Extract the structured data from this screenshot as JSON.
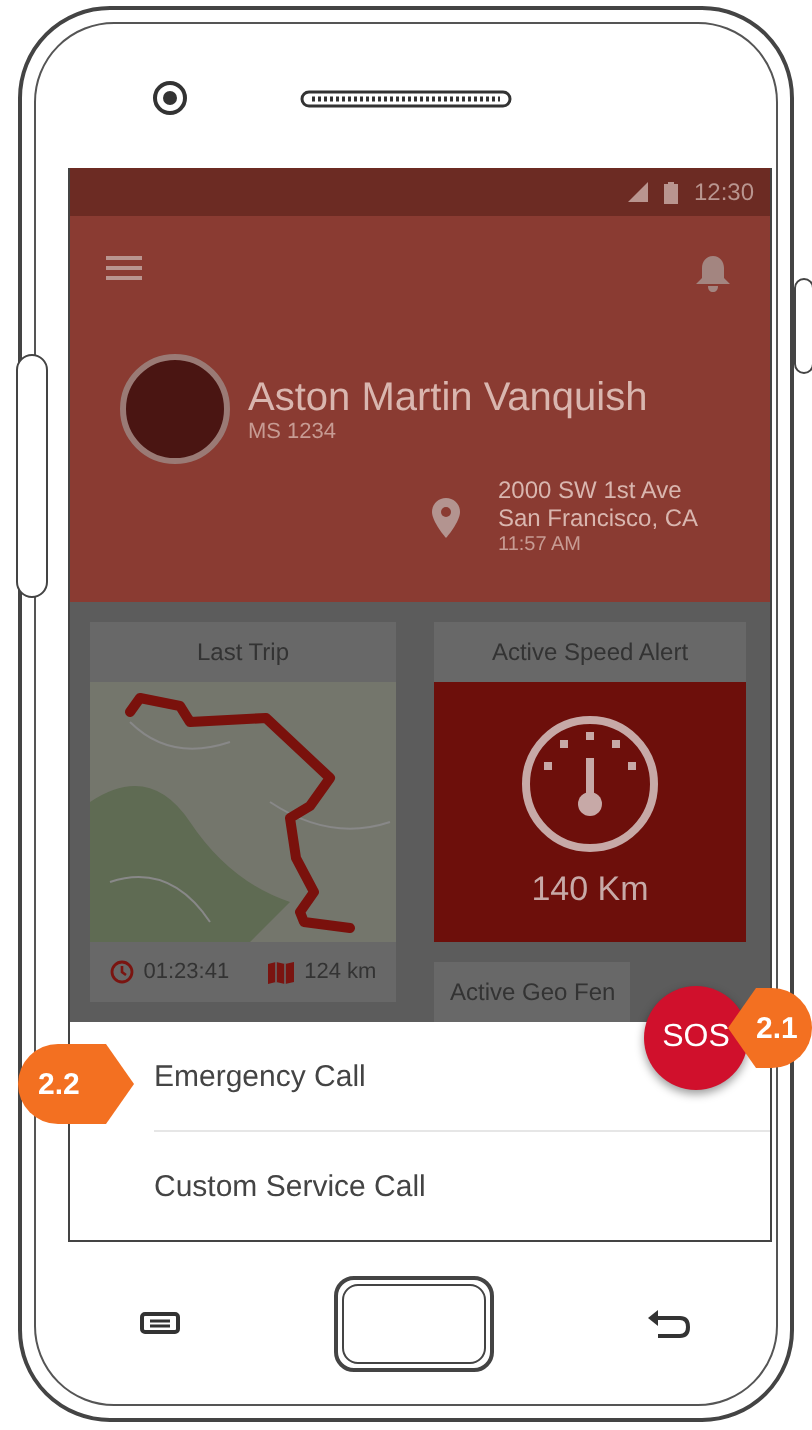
{
  "status_bar": {
    "time": "12:30"
  },
  "vehicle": {
    "name": "Aston Martin Vanquish",
    "plate": "MS 1234",
    "address_line_1": "2000 SW 1st Ave",
    "address_line_2": "San Francisco, CA",
    "time": "11:57 AM"
  },
  "cards": [
    {
      "kind": "trip",
      "title": "Last Trip",
      "duration": "01:23:41",
      "distance": "124 km"
    },
    {
      "kind": "speed",
      "title": "Active Speed Alert",
      "value": "140 Km"
    },
    {
      "kind": "geofence",
      "title": "Active Geo Fen"
    }
  ],
  "sos_button": {
    "label": "SOS"
  },
  "menu": [
    {
      "label": "Emergency Call"
    },
    {
      "label": "Custom Service Call"
    }
  ],
  "callouts": [
    {
      "label": "2.1",
      "kind": "left"
    },
    {
      "label": "2.2",
      "kind": "right"
    }
  ]
}
